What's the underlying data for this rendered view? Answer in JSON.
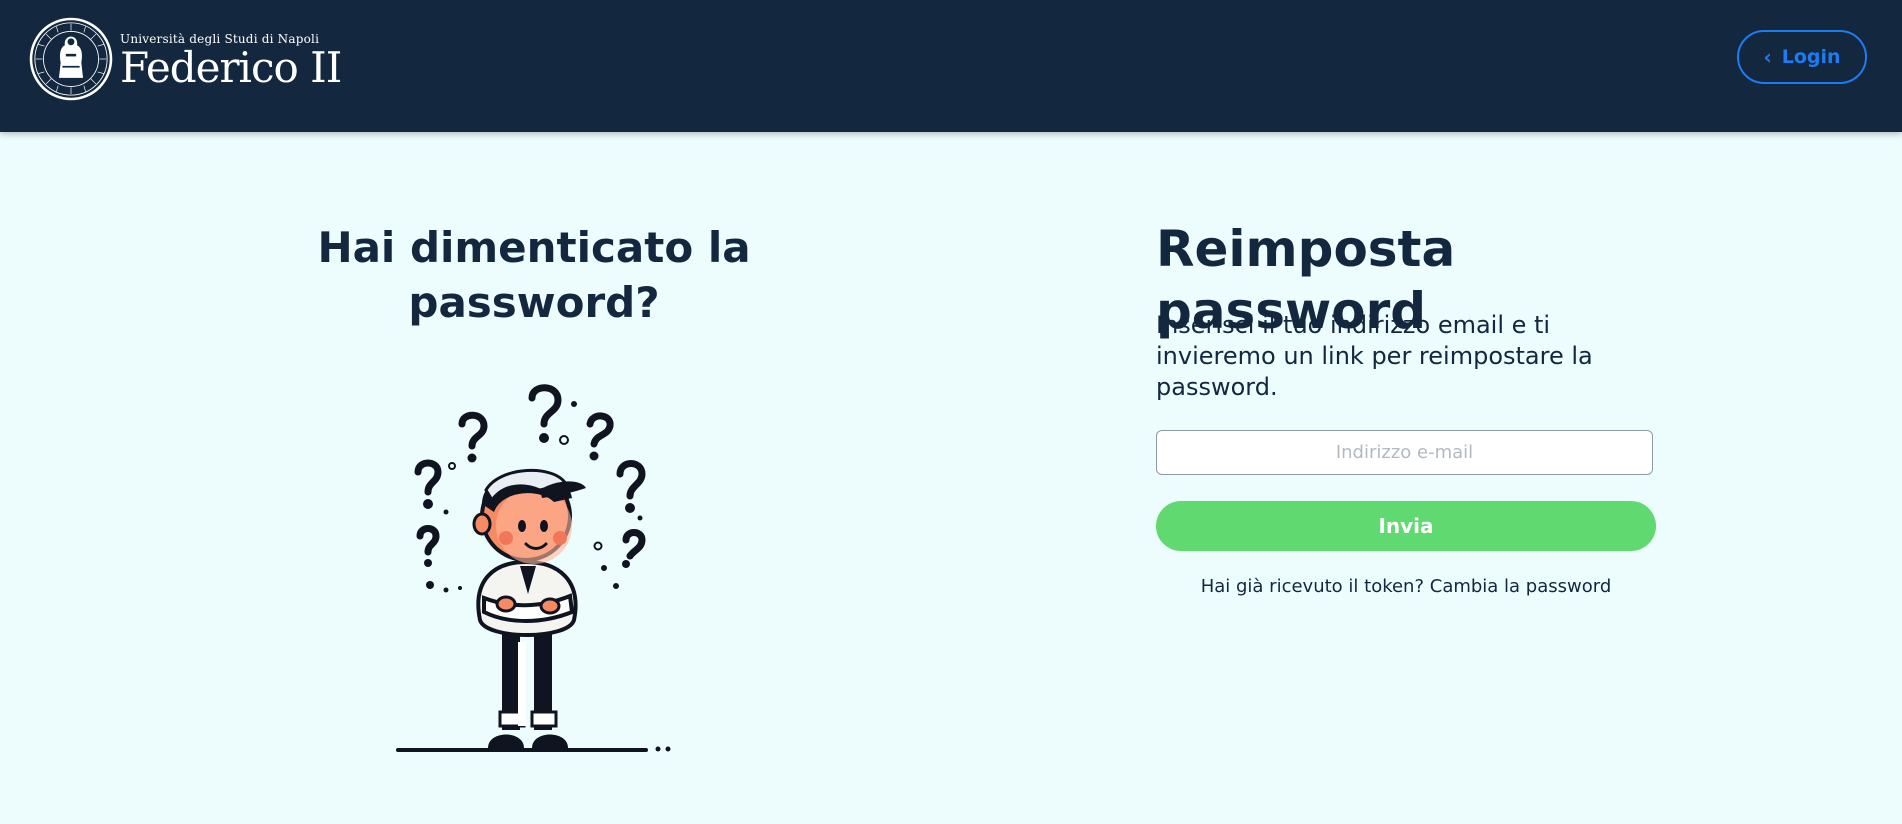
{
  "header": {
    "university_line": "Università degli Studi di Napoli",
    "university_name": "Federico II",
    "login_label": "Login",
    "login_icon": "chevron-left-icon",
    "background_color": "#13273f",
    "accent_color": "#1d7cf2"
  },
  "left": {
    "title": "Hai dimenticato la password?",
    "illustration": "confused-person-illustration"
  },
  "form": {
    "title": "Reimposta password",
    "description": "Inserisci il tuo indirizzo email e ti invieremo un link per reimpostare la password.",
    "email_placeholder": "Indirizzo e-mail",
    "email_value": "",
    "submit_label": "Invia",
    "submit_color": "#5fd970",
    "token_link": "Hai già ricevuto il token? Cambia la password"
  }
}
